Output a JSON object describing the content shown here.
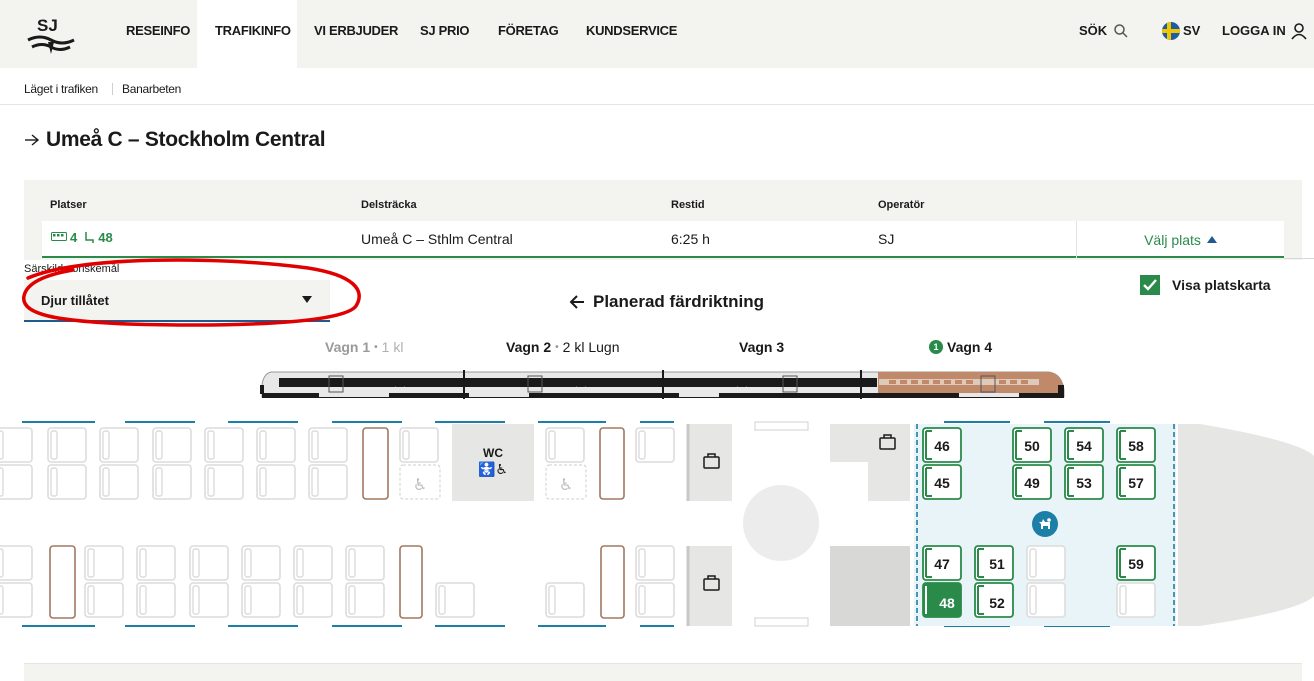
{
  "nav": {
    "items": [
      "RESEINFO",
      "TRAFIKINFO",
      "VI ERBJUDER",
      "SJ PRIO",
      "FÖRETAG",
      "KUNDSERVICE"
    ],
    "search": "SÖK",
    "language": "SV",
    "login": "LOGGA IN"
  },
  "subnav": {
    "items": [
      "Läget i trafiken",
      "Banarbeten"
    ]
  },
  "page": {
    "title": "Umeå C – Stockholm Central"
  },
  "trip": {
    "headers": {
      "seats": "Platser",
      "segment": "Delsträcka",
      "duration": "Restid",
      "operator": "Operatör"
    },
    "seats": {
      "car": "4",
      "seat": "48"
    },
    "segment": "Umeå C – Sthlm Central",
    "duration": "6:25 h",
    "operator": "SJ",
    "choose_seat": "Välj plats"
  },
  "options": {
    "special_label": "Särskilda önskemål",
    "special_value": "Djur tillåtet",
    "direction": "Planerad färdriktning",
    "show_map": "Visa platskarta",
    "show_map_checked": true
  },
  "wagons": [
    {
      "name": "Vagn 1",
      "sub": "1 kl",
      "muted": true
    },
    {
      "name": "Vagn 2",
      "sub": "2 kl Lugn",
      "muted": false
    },
    {
      "name": "Vagn 3",
      "sub": "",
      "muted": false
    },
    {
      "name": "Vagn 4",
      "sub": "",
      "badge": "1",
      "selected": true
    }
  ],
  "seatmap": {
    "wc_label": "WC",
    "seats": [
      {
        "n": "46",
        "selected": false
      },
      {
        "n": "45",
        "selected": false
      },
      {
        "n": "50",
        "selected": false
      },
      {
        "n": "49",
        "selected": false
      },
      {
        "n": "54",
        "selected": false
      },
      {
        "n": "53",
        "selected": false
      },
      {
        "n": "58",
        "selected": false
      },
      {
        "n": "57",
        "selected": false
      },
      {
        "n": "47",
        "selected": false
      },
      {
        "n": "48",
        "selected": true
      },
      {
        "n": "51",
        "selected": false
      },
      {
        "n": "52",
        "selected": false
      },
      {
        "n": "59",
        "selected": false
      }
    ]
  },
  "colors": {
    "green": "#2a8a4a",
    "blue": "#1e5a8e",
    "teal": "#1b7fa6",
    "copper": "#c08a6a",
    "annotation": "#e00000"
  }
}
